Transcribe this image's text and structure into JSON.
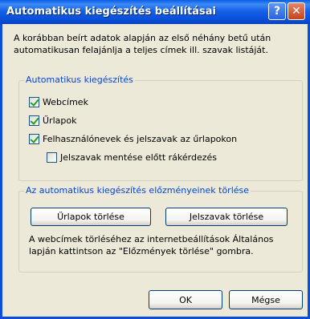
{
  "window": {
    "title": "Automatikus kiegészítés beállításai",
    "help_button": "?",
    "close_button": "✕"
  },
  "intro_text": "A korábban beírt adatok alapján az első néhány betű után automatikusan felajánlja a teljes címek ill. szavak listáját.",
  "autocomplete_group": {
    "title": "Automatikus kiegészítés",
    "options": [
      {
        "label": "Webcímek",
        "checked": true
      },
      {
        "label": "Űrlapok",
        "checked": true
      },
      {
        "label": "Felhasználónevek és jelszavak az űrlapokon",
        "checked": true
      },
      {
        "label": "Jelszavak mentése előtt rákérdezés",
        "checked": false
      }
    ]
  },
  "history_group": {
    "title": "Az automatikus kiegészítés előzményeinek törlése",
    "clear_forms_button": "Űrlapok törlése",
    "clear_passwords_button": "Jelszavak törlése",
    "note": "A webcímek törléséhez az internetbeállítások Általános lapján kattintson az \"Előzmények törlése\" gombra."
  },
  "buttons": {
    "ok": "OK",
    "cancel": "Mégse"
  },
  "colors": {
    "titlebar": "#0a4fd8",
    "dialog_bg": "#ece9d8",
    "group_title": "#0046d5"
  }
}
